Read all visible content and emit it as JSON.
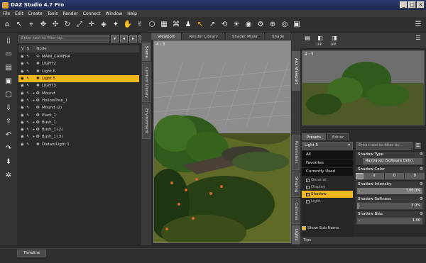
{
  "window": {
    "title": "DAZ Studio 4.7 Pro",
    "buttons": [
      "_",
      "□",
      "✕"
    ]
  },
  "menu": [
    "File",
    "Edit",
    "Create",
    "Tools",
    "Render",
    "Connect",
    "Window",
    "Help"
  ],
  "toolbar": {
    "icons": [
      "home-icon",
      "help-pointer-icon",
      "node-select-icon",
      "universal-tool-icon",
      "translate-icon",
      "rotate-icon",
      "scale-icon",
      "joint-editor-icon",
      "geometry-editor-icon",
      "spot-render-icon",
      "active-pose-icon",
      "pose-tool-icon",
      "surface-selection-icon",
      "region-icon",
      "node-tool-icon",
      "figure-tool-icon",
      "select-pointer-icon",
      "cursor-icon",
      "camera-orbit-icon",
      "light-icon",
      "render-icon",
      "render-settings-icon",
      "zoom-icon",
      "iray-icon",
      "frame-icon"
    ]
  },
  "scene": {
    "filter_placeholder": "Enter text to filter by...",
    "columns": {
      "v": "V",
      "s": "S",
      "node": "Node"
    },
    "nodes": [
      {
        "name": "MAIN_CAMERA",
        "icon": "camera",
        "expand": false,
        "selected": false
      },
      {
        "name": "LIGHT2",
        "icon": "light",
        "expand": false,
        "selected": false
      },
      {
        "name": "Light 6",
        "icon": "light",
        "expand": false,
        "selected": false
      },
      {
        "name": "Light 5",
        "icon": "light",
        "expand": false,
        "selected": true
      },
      {
        "name": "LIGHT3",
        "icon": "light",
        "expand": false,
        "selected": false
      },
      {
        "name": "Mound",
        "icon": "figure",
        "expand": true,
        "selected": false
      },
      {
        "name": "HollowTree_1",
        "icon": "figure",
        "expand": true,
        "selected": false
      },
      {
        "name": "Mound (2)",
        "icon": "figure",
        "expand": false,
        "selected": false
      },
      {
        "name": "Plant_1",
        "icon": "figure",
        "expand": false,
        "selected": false
      },
      {
        "name": "Bush_1",
        "icon": "figure",
        "expand": true,
        "selected": false
      },
      {
        "name": "Bush_1 (2)",
        "icon": "figure",
        "expand": true,
        "selected": false
      },
      {
        "name": "Bush_1 (3)",
        "icon": "figure",
        "expand": true,
        "selected": false
      },
      {
        "name": "DistantLight 1",
        "icon": "light",
        "expand": false,
        "selected": false
      }
    ]
  },
  "left_side_tabs": [
    "Scene",
    "Content Library",
    "Environment"
  ],
  "viewport": {
    "tabs": [
      "Viewport",
      "Render Library",
      "Shader Mixer",
      "Shade"
    ],
    "label": "4 : 3"
  },
  "aux": {
    "side_tab": "Aux Viewport",
    "label": "4 : 3",
    "btn_labels": [
      "1PR",
      "1PR"
    ]
  },
  "right_side_tabs": [
    "Parameters",
    "Shaping",
    "Cameras",
    "Lights"
  ],
  "panel": {
    "tabs": [
      "Presets",
      "Editor"
    ],
    "dropdown": "Light 5",
    "categories": [
      "All",
      "Favorites",
      "Currently Used"
    ],
    "subcategories": [
      {
        "label": "General",
        "selected": false
      },
      {
        "label": "Display",
        "selected": false
      },
      {
        "label": "Shadow",
        "selected": true
      },
      {
        "label": "Light",
        "selected": false
      }
    ],
    "show_sub_items": "Show Sub Items",
    "filter_placeholder": "Enter text to filter by...",
    "params": {
      "shadow_type": {
        "name": "Shadow Type",
        "value": "Raytraced (Software Only)"
      },
      "shadow_color": {
        "name": "Shadow Color",
        "r": "0",
        "g": "0",
        "b": "0"
      },
      "shadow_intensity": {
        "name": "Shadow Intensity",
        "value": "100.0%",
        "fraction": 1.0
      },
      "shadow_softness": {
        "name": "Shadow Softness",
        "value": "3.0%",
        "fraction": 0.03
      },
      "shadow_bias": {
        "name": "Shadow Bias",
        "value": "1.00",
        "fraction": 0.0
      }
    }
  },
  "tips": "Tips",
  "timeline": "Timeline"
}
